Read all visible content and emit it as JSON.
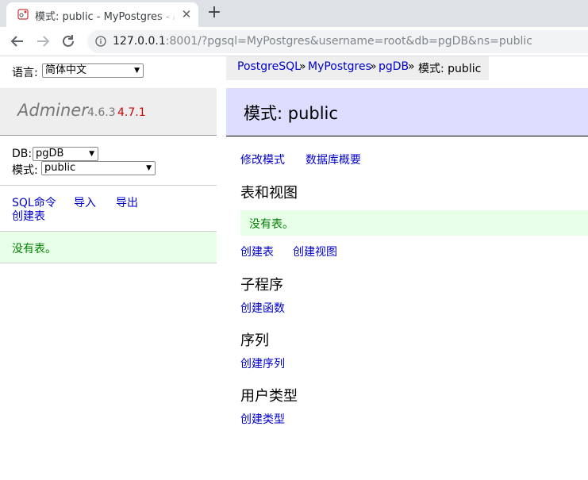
{
  "browser": {
    "tab_title": "模式: public - MyPostgres - Adminer",
    "new_tab_symbol": "+",
    "close_symbol": "✕",
    "url_host": "127.0.0.1",
    "url_rest": ":8001/?pgsql=MyPostgres&username=root&db=pgDB&ns=public"
  },
  "lang": {
    "label": "语言:",
    "selected": "简体中文"
  },
  "logo": {
    "name": "Adminer",
    "version": "4.6.3",
    "new_version": "4.7.1"
  },
  "db_form": {
    "db_label": "DB:",
    "db_selected": "pgDB",
    "schema_label": "模式:",
    "schema_selected": "public"
  },
  "menu": {
    "sql_command": "SQL命令",
    "import": "导入",
    "export": "导出",
    "create_table": "创建表"
  },
  "left_message": "没有表。",
  "breadcrumb": {
    "items": [
      "PostgreSQL",
      "MyPostgres",
      "pgDB"
    ],
    "separator": "»",
    "current": "模式: public"
  },
  "page_title": "模式: public",
  "actions": {
    "alter_schema": "修改模式",
    "db_overview": "数据库概要"
  },
  "sections": {
    "tables_views": {
      "heading": "表和视图",
      "message": "没有表。",
      "create_table": "创建表",
      "create_view": "创建视图"
    },
    "routines": {
      "heading": "子程序",
      "create_function": "创建函数"
    },
    "sequences": {
      "heading": "序列",
      "create_sequence": "创建序列"
    },
    "types": {
      "heading": "用户类型",
      "create_type": "创建类型"
    }
  },
  "colors": {
    "link": "#0000cc",
    "message_bg": "#e7ffe7",
    "message_text": "#008000",
    "title_bg": "#ddddff",
    "new_version": "#cc0000"
  }
}
